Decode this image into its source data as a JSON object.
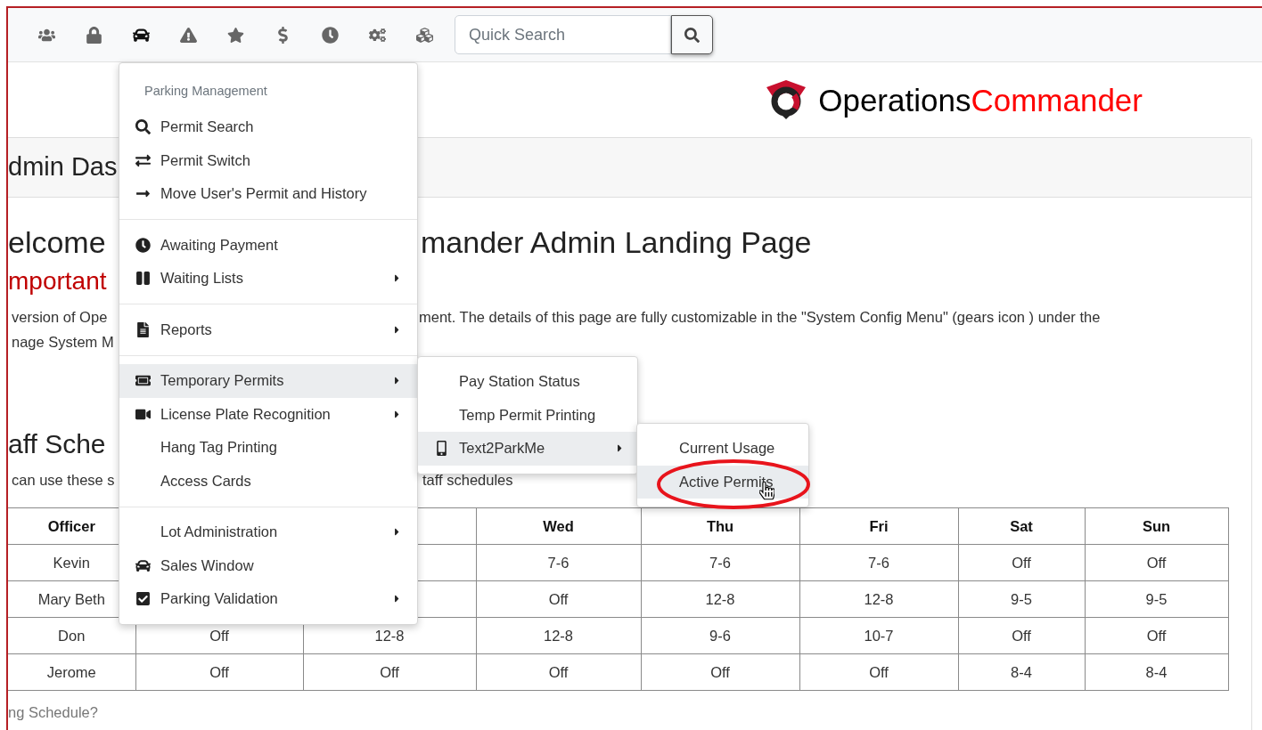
{
  "toolbar": {
    "buttons": [
      {
        "kind": "users",
        "selected": false
      },
      {
        "kind": "lock",
        "selected": false
      },
      {
        "kind": "car",
        "selected": true
      },
      {
        "kind": "warning",
        "selected": false
      },
      {
        "kind": "star",
        "selected": false
      },
      {
        "kind": "dollar",
        "selected": false
      },
      {
        "kind": "clock",
        "selected": false
      },
      {
        "kind": "cogs",
        "selected": false
      },
      {
        "kind": "cubes",
        "selected": false
      }
    ],
    "search": {
      "placeholder": "Quick Search"
    }
  },
  "logo": {
    "first": "Operations",
    "second": "Commander"
  },
  "card": {
    "header": "dmin Das",
    "welcome": {
      "left": "elcome",
      "right": "mander Admin Landing Page"
    },
    "important": "mportant",
    "paragraph": [
      {
        "left": "version of Ope",
        "right": "ment.  The details of this page are fully customizable in the \"System Config Menu\" (gears icon ) under the"
      },
      {
        "left": "nage System M"
      }
    ],
    "staff_heading": "aff Sche",
    "staff_text": {
      "left": "can use these s",
      "right": "taff schedules"
    },
    "table": {
      "columns": [
        "Officer",
        null,
        null,
        "Wed",
        "Thu",
        "Fri",
        "Sat",
        "Sun"
      ],
      "rows": [
        [
          "Kevin",
          null,
          null,
          "7-6",
          "7-6",
          "7-6",
          "Off",
          "Off"
        ],
        [
          "Mary Beth",
          null,
          null,
          "Off",
          "12-8",
          "12-8",
          "9-5",
          "9-5"
        ],
        [
          "Don",
          "Off",
          "12-8",
          "12-8",
          "9-6",
          "10-7",
          "Off",
          "Off"
        ],
        [
          "Jerome",
          "Off",
          "Off",
          "Off",
          "Off",
          "Off",
          "8-4",
          "8-4"
        ]
      ]
    },
    "footer_link": "ng Schedule?"
  },
  "menu": {
    "header": "Parking Management",
    "sections": [
      {
        "items": [
          {
            "label": "Permit Search",
            "kind": "search",
            "submenu": false,
            "selected": false
          },
          {
            "label": "Permit Switch",
            "kind": "exchange",
            "submenu": false,
            "selected": false
          },
          {
            "label": "Move User's Permit and History",
            "kind": "arrow",
            "submenu": false,
            "selected": false
          }
        ]
      },
      {
        "items": [
          {
            "label": "Awaiting Payment",
            "kind": "clock",
            "submenu": false,
            "selected": false
          },
          {
            "label": "Waiting Lists",
            "kind": "pause",
            "submenu": true,
            "selected": false
          }
        ]
      },
      {
        "items": [
          {
            "label": "Reports",
            "kind": "file",
            "submenu": true,
            "selected": false
          }
        ]
      },
      {
        "items": [
          {
            "label": "Temporary Permits",
            "kind": "ticket",
            "submenu": true,
            "selected": true
          },
          {
            "label": "License Plate Recognition",
            "kind": "video",
            "submenu": true,
            "selected": false
          },
          {
            "label": "Hang Tag Printing",
            "kind": "plain",
            "submenu": false,
            "selected": false
          },
          {
            "label": "Access Cards",
            "kind": "plain",
            "submenu": false,
            "selected": false
          }
        ]
      },
      {
        "items": [
          {
            "label": "Lot Administration",
            "kind": "plain",
            "submenu": true,
            "selected": false
          },
          {
            "label": "Sales Window",
            "kind": "car",
            "submenu": false,
            "selected": false
          },
          {
            "label": "Parking Validation",
            "kind": "check",
            "submenu": true,
            "selected": false
          }
        ]
      }
    ]
  },
  "submenu": {
    "items": [
      {
        "label": "Pay Station Status",
        "kind": "plain",
        "submenu": false,
        "selected": false
      },
      {
        "label": "Temp Permit Printing",
        "kind": "plain",
        "submenu": false,
        "selected": false
      },
      {
        "label": "Text2ParkMe",
        "kind": "mobile",
        "submenu": true,
        "selected": true
      }
    ]
  },
  "submenu2": {
    "items": [
      {
        "label": "Current Usage",
        "selected": false
      },
      {
        "label": "Active Permits",
        "selected": true
      }
    ]
  }
}
